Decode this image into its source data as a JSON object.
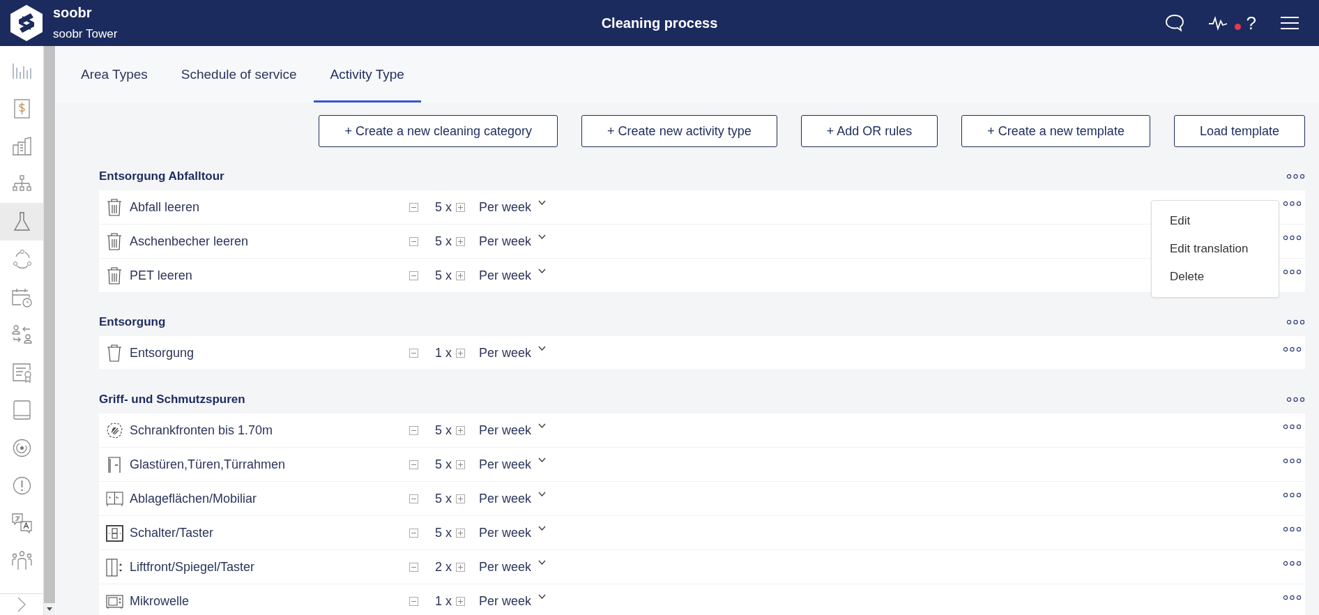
{
  "header": {
    "brand": "soobr",
    "site": "soobr Tower",
    "title": "Cleaning process",
    "alert": true,
    "help": "?"
  },
  "sidebar": {
    "items": [
      {
        "selected": false
      },
      {
        "selected": false
      },
      {
        "selected": false
      },
      {
        "selected": false
      },
      {
        "selected": true
      },
      {
        "selected": false
      },
      {
        "selected": false
      },
      {
        "selected": false
      },
      {
        "selected": false
      },
      {
        "selected": false
      },
      {
        "selected": false
      },
      {
        "selected": false
      },
      {
        "selected": false
      },
      {
        "selected": false
      }
    ]
  },
  "tabs": [
    {
      "label": "Area Types",
      "selected": false
    },
    {
      "label": "Schedule of service",
      "selected": false
    },
    {
      "label": "Activity Type",
      "selected": true
    }
  ],
  "actions": [
    "+ Create a new cleaning category",
    "+ Create new activity type",
    "+ Add OR rules",
    "+ Create a new template",
    "Load template"
  ],
  "sections": [
    {
      "title": "Entsorgung Abfalltour",
      "activities": [
        {
          "name": "Abfall leeren",
          "count": "5",
          "unit": "x",
          "frequency": "Per week",
          "menu_open": true
        },
        {
          "name": "Aschenbecher leeren",
          "count": "5",
          "unit": "x",
          "frequency": "Per week",
          "menu_open": false
        },
        {
          "name": "PET leeren",
          "count": "5",
          "unit": "x",
          "frequency": "Per week",
          "menu_open": false
        }
      ]
    },
    {
      "title": "Entsorgung",
      "activities": [
        {
          "name": "Entsorgung",
          "count": "1",
          "unit": "x",
          "frequency": "Per week",
          "menu_open": false
        }
      ]
    },
    {
      "title": "Griff- und Schmutzspuren",
      "activities": [
        {
          "name": "Schrankfronten bis 1.70m",
          "count": "5",
          "unit": "x",
          "frequency": "Per week",
          "menu_open": false
        },
        {
          "name": "Glastüren,Türen,Türrahmen",
          "count": "5",
          "unit": "x",
          "frequency": "Per week",
          "menu_open": false
        },
        {
          "name": "Ablageflächen/Mobiliar",
          "count": "5",
          "unit": "x",
          "frequency": "Per week",
          "menu_open": false
        },
        {
          "name": "Schalter/Taster",
          "count": "5",
          "unit": "x",
          "frequency": "Per week",
          "menu_open": false
        },
        {
          "name": "Liftfront/Spiegel/Taster",
          "count": "2",
          "unit": "x",
          "frequency": "Per week",
          "menu_open": false
        },
        {
          "name": "Mikrowelle",
          "count": "1",
          "unit": "x",
          "frequency": "Per week",
          "menu_open": false
        }
      ]
    }
  ],
  "context_menu": {
    "items": [
      "Edit",
      "Edit translation",
      "Delete"
    ]
  }
}
